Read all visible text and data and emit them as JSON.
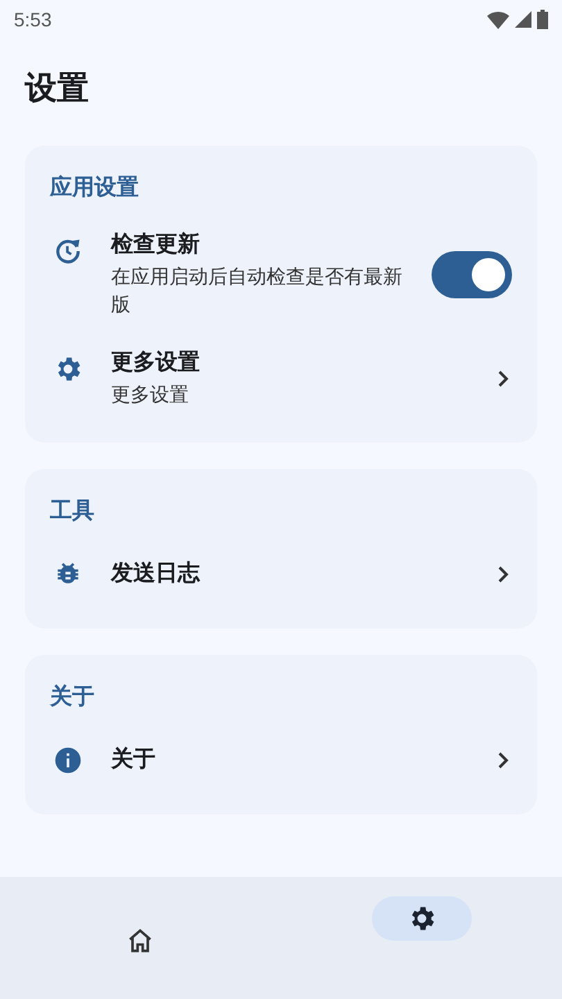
{
  "status_bar": {
    "time": "5:53"
  },
  "title": "设置",
  "sections": [
    {
      "title": "应用设置",
      "items": [
        {
          "kind": "toggle",
          "label": "检查更新",
          "subtitle": "在应用启动后自动检查是否有最新版",
          "on": true
        },
        {
          "kind": "link",
          "label": "更多设置",
          "subtitle": "更多设置"
        }
      ]
    },
    {
      "title": "工具",
      "items": [
        {
          "kind": "link",
          "label": "发送日志"
        }
      ]
    },
    {
      "title": "关于",
      "items": [
        {
          "kind": "link",
          "label": "关于"
        }
      ]
    }
  ],
  "bottom_nav": [
    {
      "selected": false
    },
    {
      "selected": true
    }
  ]
}
